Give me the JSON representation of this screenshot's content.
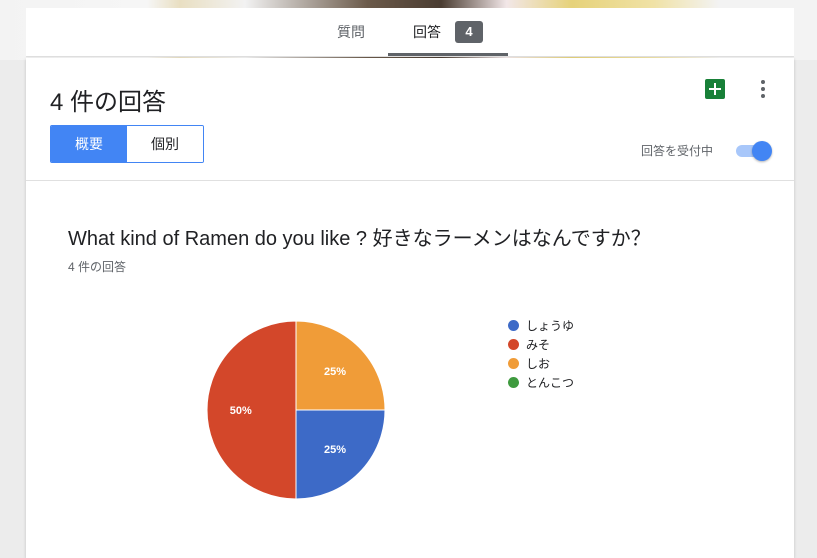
{
  "tabs": {
    "questions_label": "質問",
    "responses_label": "回答",
    "responses_count": "4"
  },
  "header": {
    "title": "4 件の回答",
    "sheets_icon": "google-sheets-icon",
    "more_icon": "more-vert-icon"
  },
  "view_toggle": {
    "summary_label": "概要",
    "individual_label": "個別",
    "selected": "概要"
  },
  "accepting": {
    "label": "回答を受付中",
    "enabled": true
  },
  "question": {
    "title": "What kind of Ramen do you like ? 好きなラーメンはなんですか？",
    "response_count": "4 件の回答"
  },
  "colors": {
    "accent": "#4285f4",
    "sheets_green": "#188038"
  },
  "chart_data": {
    "type": "pie",
    "categories": [
      "しょうゆ",
      "みそ",
      "しお",
      "とんこつ"
    ],
    "values": [
      25,
      50,
      25,
      0
    ],
    "labels": [
      "25%",
      "50%",
      "25%",
      ""
    ],
    "colors": [
      "#3d6ac7",
      "#d3472a",
      "#f09c38",
      "#3e9a3e"
    ],
    "legend_position": "right"
  }
}
